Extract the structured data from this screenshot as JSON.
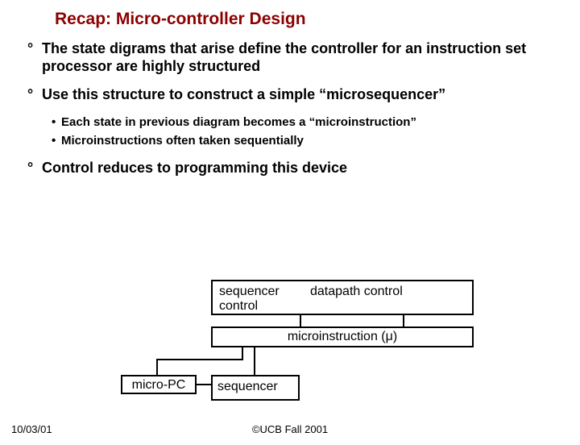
{
  "title": "Recap: Micro-controller Design",
  "bullets": {
    "b1": "The state digrams that arise define the controller for an instruction set processor are highly structured",
    "b2": "Use this structure to construct a simple “microsequencer”",
    "b2a": "Each state in previous diagram becomes a “microinstruction”",
    "b2b": "Microinstructions often taken sequentially",
    "b3": "Control reduces to programming this device"
  },
  "diagram": {
    "seq_control": "sequencer control",
    "dp_control": "datapath control",
    "microinst": "microinstruction (μ)",
    "micro_pc": "micro-PC",
    "sequencer": "sequencer"
  },
  "footer": {
    "date": "10/03/01",
    "copyright": "©UCB Fall 2001"
  }
}
